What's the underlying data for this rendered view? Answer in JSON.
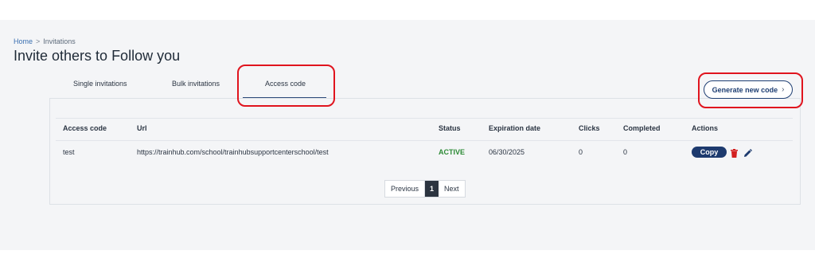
{
  "breadcrumb": {
    "home": "Home",
    "separator": ">",
    "current": "Invitations"
  },
  "page": {
    "title": "Invite others to Follow you"
  },
  "tabs": [
    {
      "label": "Single invitations"
    },
    {
      "label": "Bulk invitations"
    },
    {
      "label": "Access code",
      "active": true
    }
  ],
  "toolbar": {
    "generate_label": "Generate new code",
    "generate_icon": "chevron-right-icon"
  },
  "table": {
    "headers": [
      "Access code",
      "Url",
      "Status",
      "Expiration date",
      "Clicks",
      "Completed",
      "Actions"
    ],
    "rows": [
      {
        "access_code": "test",
        "url": "https://trainhub.com/school/trainhubsupportcenterschool/test",
        "status": "ACTIVE",
        "expiration": "06/30/2025",
        "clicks": "0",
        "completed": "0",
        "copy_label": "Copy"
      }
    ]
  },
  "pagination": {
    "previous": "Previous",
    "current": "1",
    "next": "Next"
  },
  "colors": {
    "accent": "#1d3a6e",
    "status_active": "#2c8a35",
    "highlight": "#e0141e",
    "delete": "#d32020"
  }
}
